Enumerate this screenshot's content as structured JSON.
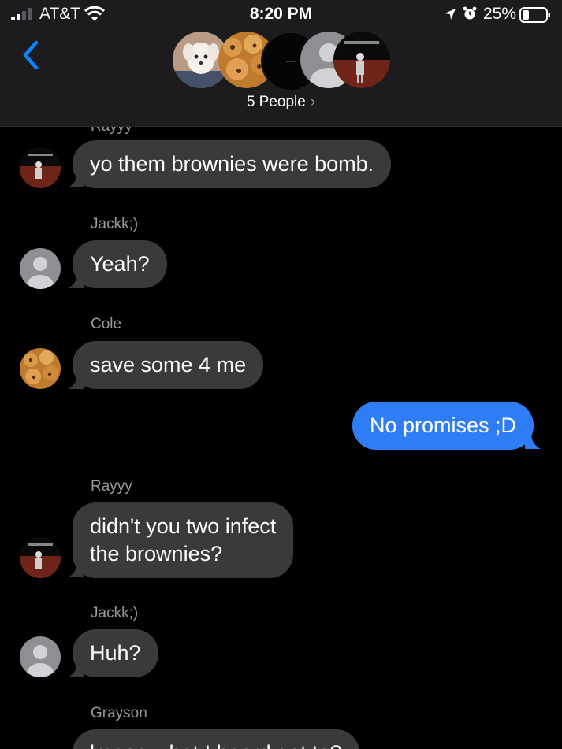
{
  "status_bar": {
    "carrier": "AT&T",
    "time": "8:20 PM",
    "battery": "25%"
  },
  "header": {
    "group_label": "5 People",
    "chevron": "›"
  },
  "colors": {
    "incoming_bubble": "#3a3a3c",
    "outgoing_bubble": "#2f7df6",
    "accent": "#0a84ff"
  },
  "messages": [
    {
      "sender": "Rayyy",
      "text": "yo them brownies were bomb.",
      "avatar": "figure-avatar-icon"
    },
    {
      "sender": "Jackk;)",
      "text": "Yeah?",
      "avatar": "default-person-avatar-icon"
    },
    {
      "sender": "Cole",
      "text": "save some 4 me",
      "avatar": "cookie-avatar-icon"
    },
    {
      "sender": "",
      "text": "No promises ;D",
      "direction": "outgoing"
    },
    {
      "sender": "Rayyy",
      "text": "didn't you two infect\nthe brownies?",
      "avatar": "figure-avatar-icon"
    },
    {
      "sender": "Jackk;)",
      "text": "Huh?",
      "avatar": "default-person-avatar-icon"
    },
    {
      "sender": "Grayson",
      "text": "lmaoo what I heard get to?",
      "avatar": ""
    }
  ]
}
